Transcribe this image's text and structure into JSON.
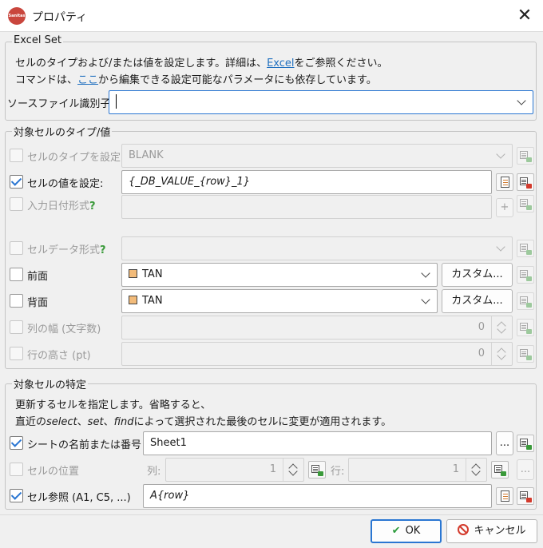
{
  "window": {
    "title": "プロパティ",
    "app_icon_text": "Sanitas Data",
    "close_glyph": "✕"
  },
  "excel_set": {
    "legend": "Excel Set",
    "desc_line1_a": "セルのタイプおよび/または値を設定します。詳細は、",
    "desc_line1_link": "Excel",
    "desc_line1_b": "をご参照ください。",
    "desc_line2_a": "コマンドは、",
    "desc_line2_link": "ここ",
    "desc_line2_b": "から編集できる設定可能なパラメータにも依存しています。",
    "source_label": "ソースファイル識別子",
    "source_value": ""
  },
  "cell_type_value": {
    "legend": "対象セルのタイプ/値",
    "set_type": {
      "label": "セルのタイプを設定:",
      "checked": false,
      "enabled": false,
      "value": "BLANK"
    },
    "set_value": {
      "label": "セルの値を設定:",
      "checked": true,
      "enabled": true,
      "value": "{_DB_VALUE_{row}_1}"
    },
    "input_date": {
      "label": "入力日付形式",
      "help": "?",
      "checked": false,
      "enabled": false,
      "value": "",
      "plus": "+"
    },
    "data_format": {
      "label": "セルデータ形式",
      "help": "?",
      "checked": false,
      "enabled": false,
      "value": ""
    },
    "foreground": {
      "label": "前面",
      "checked": false,
      "value": "TAN",
      "custom_label": "カスタム..."
    },
    "background": {
      "label": "背面",
      "checked": false,
      "value": "TAN",
      "custom_label": "カスタム..."
    },
    "col_width": {
      "label": "列の幅 (文字数)",
      "checked": false,
      "value": "0"
    },
    "row_height": {
      "label": "行の高さ (pt)",
      "checked": false,
      "value": "0"
    }
  },
  "target_cell": {
    "legend": "対象セルの特定",
    "desc_line1": "更新するセルを指定します。省略すると、",
    "desc_line2_a": "直近の",
    "desc_line2_select": "select",
    "desc_line2_sep1": "、",
    "desc_line2_set": "set",
    "desc_line2_sep2": "、",
    "desc_line2_find": "find",
    "desc_line2_b": "によって選択された最後のセルに変更が適用されます。",
    "sheet": {
      "label": "シートの名前または番号",
      "checked": true,
      "value": "Sheet1",
      "browse": "..."
    },
    "position": {
      "label": "セルの位置",
      "checked": false,
      "col_label": "列:",
      "col_value": "1",
      "row_label": "行:",
      "row_value": "1",
      "browse": "..."
    },
    "cell_ref": {
      "label": "セル参照 (A1, C5, ...)",
      "checked": true,
      "value": "A{row}"
    }
  },
  "footer": {
    "ok_label": "OK",
    "cancel_label": "キャンセル"
  },
  "colors": {
    "accent": "#2a76d2",
    "link": "#1f6fbf",
    "tan_swatch": "#f2bb7a",
    "help_green": "#3a9a3a"
  }
}
